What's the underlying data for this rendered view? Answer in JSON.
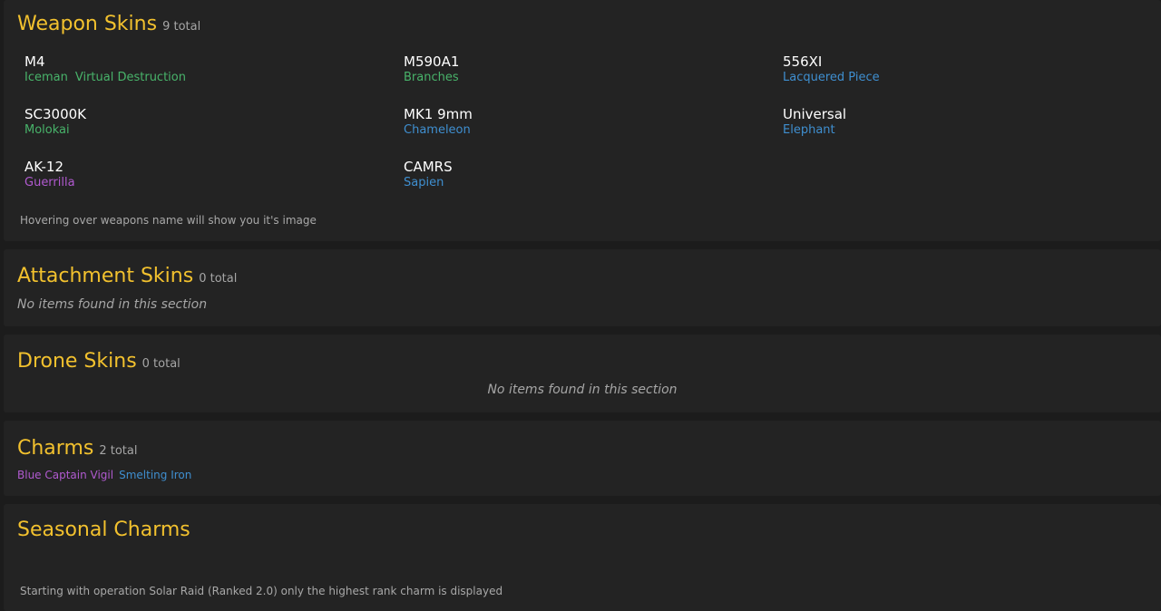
{
  "weapon_skins": {
    "title": "Weapon Skins",
    "count": "9 total",
    "weapons": [
      {
        "name": "M4",
        "skins": [
          {
            "label": "Iceman",
            "rarity": "green"
          },
          {
            "label": "Virtual Destruction",
            "rarity": "green"
          }
        ]
      },
      {
        "name": "M590A1",
        "skins": [
          {
            "label": "Branches",
            "rarity": "green"
          }
        ]
      },
      {
        "name": "556XI",
        "skins": [
          {
            "label": "Lacquered Piece",
            "rarity": "blue"
          }
        ]
      },
      {
        "name": "SC3000K",
        "skins": [
          {
            "label": "Molokai",
            "rarity": "green"
          }
        ]
      },
      {
        "name": "MK1 9mm",
        "skins": [
          {
            "label": "Chameleon",
            "rarity": "blue"
          }
        ]
      },
      {
        "name": "Universal",
        "skins": [
          {
            "label": "Elephant",
            "rarity": "blue"
          }
        ]
      },
      {
        "name": "AK-12",
        "skins": [
          {
            "label": "Guerrilla",
            "rarity": "purple"
          }
        ]
      },
      {
        "name": "CAMRS",
        "skins": [
          {
            "label": "Sapien",
            "rarity": "blue"
          }
        ]
      }
    ],
    "note": "Hovering over weapons name will show you it's image"
  },
  "attachment_skins": {
    "title": "Attachment Skins",
    "count": "0 total",
    "empty": "No items found in this section"
  },
  "drone_skins": {
    "title": "Drone Skins",
    "count": "0 total",
    "empty": "No items found in this section"
  },
  "charms": {
    "title": "Charms",
    "count": "2 total",
    "items": [
      {
        "label": "Blue Captain Vigil",
        "rarity": "purple"
      },
      {
        "label": "Smelting Iron",
        "rarity": "blue"
      }
    ]
  },
  "seasonal_charms": {
    "title": "Seasonal Charms",
    "note": "Starting with operation Solar Raid (Ranked 2.0) only the highest rank charm is displayed"
  },
  "colors": {
    "title": "#f2c12e",
    "green": "#48b36a",
    "blue": "#3f8fd0",
    "purple": "#b15ad0"
  }
}
